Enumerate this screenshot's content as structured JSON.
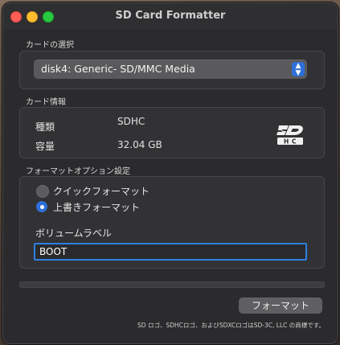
{
  "window": {
    "title": "SD Card Formatter"
  },
  "card_selection": {
    "section_label": "カードの選択",
    "selected": "disk4: Generic- SD/MMC Media"
  },
  "card_info": {
    "section_label": "カード情報",
    "type_label": "種類",
    "type_value": "SDHC",
    "capacity_label": "容量",
    "capacity_value": "32.04 GB",
    "logo_icon": "sdhc-logo-icon"
  },
  "format_options": {
    "section_label": "フォーマットオプション設定",
    "options": [
      {
        "label": "クイックフォーマット",
        "selected": false
      },
      {
        "label": "上書きフォーマット",
        "selected": true
      }
    ],
    "volume_label_title": "ボリュームラベル",
    "volume_label_value": "BOOT"
  },
  "progress": {
    "value": 0
  },
  "actions": {
    "format_button": "フォーマット"
  },
  "footnote": "SD ロゴ、SDHCロゴ、およびSDXCロゴはSD-3C, LLC の商標です。",
  "colors": {
    "accent": "#2e6fd9",
    "window_bg": "#2b2b2d",
    "traffic_close": "#ff5f57",
    "traffic_min": "#febc2e",
    "traffic_max": "#28c840"
  }
}
